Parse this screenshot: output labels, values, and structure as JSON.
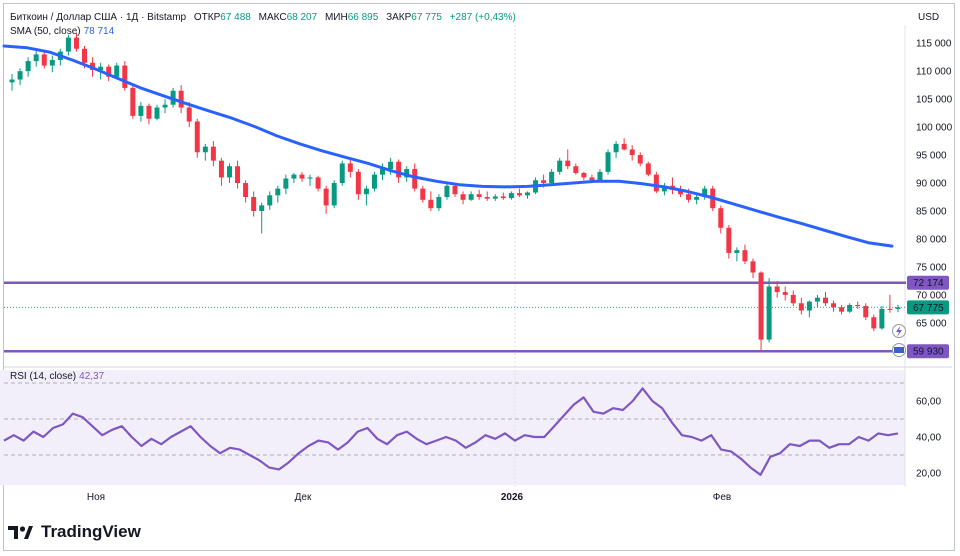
{
  "header": {
    "symbol": "Биткоин / Доллар США · 1Д · Bitstamp",
    "open_label": "ОТКР",
    "open": "67 488",
    "high_label": "МАКС",
    "high": "68 207",
    "low_label": "МИН",
    "low": "66 895",
    "close_label": "ЗАКР",
    "close": "67 775",
    "change": "+287 (+0,43%)",
    "currency": "USD",
    "sma_label": "SMA (50, close)",
    "sma_value": "78 714",
    "rsi_label": "RSI (14, close)",
    "rsi_value": "42,37"
  },
  "brand": "TradingView",
  "colors": {
    "up": "#089981",
    "down": "#f23645",
    "sma": "#2962ff",
    "level": "#7e57c2",
    "rsi": "#7e57c2"
  },
  "chart_data": [
    {
      "type": "candlestick",
      "ylim": [
        58000,
        117000
      ],
      "y_ticks": [
        "115 000",
        "110 000",
        "105 000",
        "100 000",
        "95 000",
        "90 000",
        "85 000",
        "80 000",
        "75 000",
        "70 000",
        "65 000"
      ],
      "x_ticks": [
        "Ноя",
        "Дек",
        "2026",
        "Фев"
      ],
      "price_labels": [
        "72 174",
        "67 775",
        "59 930"
      ],
      "levels": [
        72174,
        59930
      ],
      "ohlc": [
        [
          108000,
          109500,
          106500,
          108500
        ],
        [
          108500,
          110500,
          107500,
          110000
        ],
        [
          110000,
          112500,
          109000,
          111800
        ],
        [
          111800,
          114000,
          110800,
          113000
        ],
        [
          113000,
          113500,
          110500,
          111000
        ],
        [
          111000,
          112800,
          109800,
          112000
        ],
        [
          112000,
          114000,
          111000,
          113500
        ],
        [
          113500,
          116500,
          112800,
          116000
        ],
        [
          116000,
          116800,
          113500,
          114000
        ],
        [
          114000,
          114500,
          110500,
          111500
        ],
        [
          111500,
          112500,
          109000,
          110200
        ],
        [
          110200,
          111500,
          108500,
          110800
        ],
        [
          110800,
          111200,
          108200,
          109000
        ],
        [
          109000,
          111500,
          108500,
          111000
        ],
        [
          111000,
          111800,
          106500,
          107000
        ],
        [
          107000,
          107500,
          101500,
          102000
        ],
        [
          102000,
          104500,
          101000,
          103800
        ],
        [
          103800,
          104200,
          100500,
          101500
        ],
        [
          101500,
          104000,
          101200,
          103500
        ],
        [
          103500,
          105000,
          102500,
          104000
        ],
        [
          104000,
          107000,
          103500,
          106500
        ],
        [
          106500,
          107500,
          102500,
          103500
        ],
        [
          103500,
          104500,
          100000,
          101000
        ],
        [
          101000,
          101500,
          94500,
          95500
        ],
        [
          95500,
          97000,
          94000,
          96500
        ],
        [
          96500,
          97500,
          93000,
          94000
        ],
        [
          94000,
          94500,
          89500,
          91000
        ],
        [
          91000,
          93500,
          90000,
          93000
        ],
        [
          93000,
          94000,
          89000,
          90000
        ],
        [
          90000,
          90500,
          86500,
          87500
        ],
        [
          87500,
          88500,
          84000,
          85000
        ],
        [
          85000,
          86500,
          81000,
          86000
        ],
        [
          86000,
          88500,
          85200,
          87800
        ],
        [
          87800,
          89500,
          86500,
          89000
        ],
        [
          89000,
          91500,
          88000,
          90800
        ],
        [
          90800,
          91800,
          90000,
          91500
        ],
        [
          91500,
          92000,
          90200,
          90800
        ],
        [
          90800,
          91500,
          89500,
          91000
        ],
        [
          91000,
          91300,
          88500,
          89000
        ],
        [
          89000,
          89500,
          84500,
          86000
        ],
        [
          86000,
          90500,
          85500,
          90000
        ],
        [
          90000,
          94000,
          89500,
          93500
        ],
        [
          93500,
          94500,
          91000,
          92000
        ],
        [
          92000,
          92500,
          87000,
          88000
        ],
        [
          88000,
          89500,
          86000,
          89000
        ],
        [
          89000,
          92000,
          88500,
          91500
        ],
        [
          91500,
          93500,
          90500,
          92500
        ],
        [
          92500,
          94500,
          91500,
          93800
        ],
        [
          93800,
          94200,
          90000,
          91000
        ],
        [
          91000,
          93000,
          90200,
          92500
        ],
        [
          92500,
          93500,
          88500,
          89000
        ],
        [
          89000,
          89500,
          86500,
          87000
        ],
        [
          87000,
          88500,
          85000,
          85500
        ],
        [
          85500,
          88000,
          85000,
          87500
        ],
        [
          87500,
          90000,
          87000,
          89500
        ],
        [
          89500,
          90000,
          87500,
          88000
        ],
        [
          88000,
          88500,
          86200,
          87000
        ],
        [
          87000,
          88500,
          86800,
          88000
        ],
        [
          88000,
          88800,
          87000,
          87500
        ],
        [
          87500,
          88500,
          86800,
          87200
        ],
        [
          87200,
          88000,
          86800,
          87600
        ],
        [
          87600,
          88300,
          87000,
          87300
        ],
        [
          87300,
          88500,
          87000,
          88200
        ],
        [
          88200,
          89000,
          87500,
          87800
        ],
        [
          87800,
          88500,
          87200,
          88300
        ],
        [
          88300,
          91000,
          88000,
          90500
        ],
        [
          90500,
          91500,
          89200,
          90000
        ],
        [
          90000,
          92500,
          89500,
          92000
        ],
        [
          92000,
          94500,
          91500,
          94000
        ],
        [
          94000,
          96000,
          92500,
          93000
        ],
        [
          93000,
          93500,
          91500,
          91800
        ],
        [
          91800,
          92000,
          90500,
          91000
        ],
        [
          91000,
          91500,
          90000,
          90500
        ],
        [
          90500,
          92500,
          90200,
          92000
        ],
        [
          92000,
          96000,
          91500,
          95500
        ],
        [
          95500,
          97500,
          94500,
          97000
        ],
        [
          97000,
          98000,
          95800,
          96000
        ],
        [
          96000,
          96800,
          94000,
          95000
        ],
        [
          95000,
          95500,
          93000,
          93500
        ],
        [
          93500,
          93800,
          91200,
          91500
        ],
        [
          91500,
          92000,
          88200,
          88500
        ],
        [
          88500,
          90000,
          87800,
          89500
        ],
        [
          89500,
          91000,
          88000,
          88800
        ],
        [
          88800,
          89500,
          87500,
          88000
        ],
        [
          88000,
          89000,
          86500,
          87000
        ],
        [
          87000,
          88000,
          86200,
          87500
        ],
        [
          87500,
          89500,
          87000,
          89000
        ],
        [
          89000,
          89500,
          85000,
          85500
        ],
        [
          85500,
          86000,
          81000,
          82000
        ],
        [
          82000,
          82500,
          76500,
          77500
        ],
        [
          77500,
          78500,
          76000,
          78000
        ],
        [
          78000,
          79000,
          75500,
          76000
        ],
        [
          76000,
          76500,
          73000,
          74000
        ],
        [
          74000,
          74200,
          60000,
          62000
        ],
        [
          62000,
          73000,
          61500,
          71500
        ],
        [
          71500,
          72500,
          69500,
          70500
        ],
        [
          70500,
          71500,
          69000,
          70000
        ],
        [
          70000,
          70800,
          68000,
          68500
        ],
        [
          68500,
          69500,
          66500,
          67200
        ],
        [
          67200,
          69000,
          66000,
          68800
        ],
        [
          68800,
          70000,
          67800,
          69500
        ],
        [
          69500,
          70500,
          68000,
          68500
        ],
        [
          68500,
          69000,
          67000,
          67800
        ],
        [
          67800,
          68200,
          66500,
          67000
        ],
        [
          67000,
          68500,
          66800,
          68200
        ],
        [
          68200,
          68800,
          67500,
          68000
        ],
        [
          68000,
          68500,
          65500,
          66000
        ],
        [
          66000,
          66500,
          63500,
          64000
        ],
        [
          64000,
          68000,
          63800,
          67500
        ],
        [
          67500,
          70000,
          66800,
          67488
        ],
        [
          67488,
          68207,
          66895,
          67775
        ]
      ],
      "sma": [
        114500,
        114200,
        113400,
        112000,
        110400,
        108700,
        107000,
        105600,
        104200,
        102900,
        101600,
        100100,
        98400,
        97000,
        95700,
        94600,
        93500,
        92200,
        91100,
        90300,
        89700,
        89400,
        89300,
        89400,
        89700,
        90000,
        90300,
        90300,
        89900,
        89300,
        88500,
        87500,
        86300,
        85100,
        83900,
        82800,
        81600,
        80400,
        79300,
        78714
      ]
    },
    {
      "type": "line",
      "name": "RSI (14, close)",
      "ylim": [
        15,
        75
      ],
      "y_ticks": [
        "60,00",
        "40,00",
        "20,00"
      ],
      "bands": [
        30,
        50,
        70
      ],
      "values": [
        38,
        41,
        38,
        43,
        40,
        45,
        47,
        53,
        51,
        46,
        41,
        44,
        46,
        40,
        35,
        39,
        36,
        40,
        43,
        46,
        40,
        35,
        31,
        34,
        33,
        30,
        27,
        23,
        22,
        26,
        31,
        35,
        38,
        37,
        33,
        37,
        43,
        45,
        39,
        36,
        41,
        43,
        39,
        36,
        38,
        40,
        38,
        34,
        37,
        41,
        39,
        42,
        38,
        41,
        40,
        40,
        46,
        52,
        58,
        62,
        54,
        53,
        56,
        55,
        60,
        67,
        60,
        56,
        48,
        41,
        40,
        38,
        41,
        33,
        32,
        28,
        23,
        19,
        29,
        31,
        36,
        35,
        38,
        38,
        34,
        36,
        36,
        40,
        38,
        42,
        41,
        42
      ]
    }
  ]
}
